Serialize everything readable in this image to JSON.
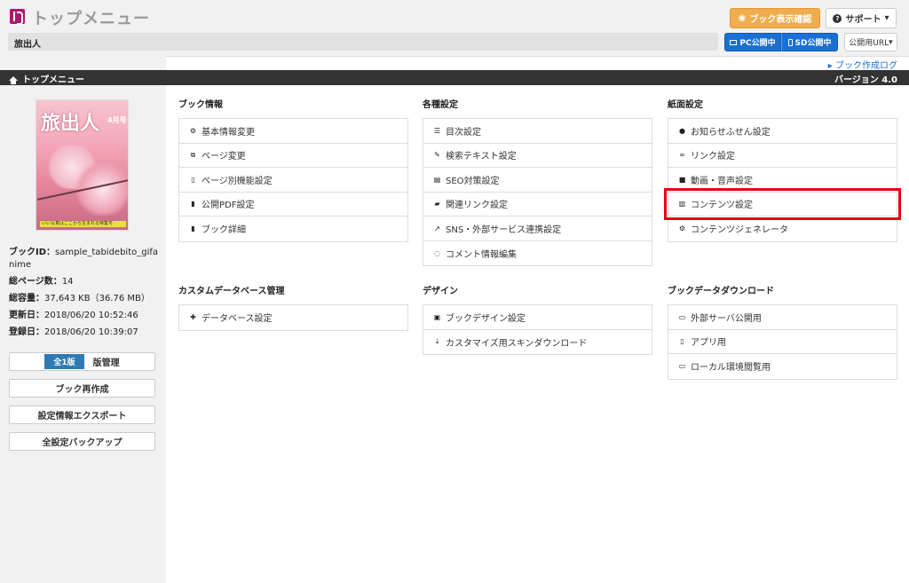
{
  "header": {
    "app_title": "トップメニュー",
    "book_view_button": "ブック表示確認",
    "support_button": "サポート",
    "book_name": "旅出人",
    "pc_publish": "PC公開中",
    "sd_publish": "SD公開中",
    "public_url": "公開用URL"
  },
  "log_link": "ブック作成ログ",
  "nav": {
    "breadcrumb": "トップメニュー",
    "version": "バージョン 4.0"
  },
  "sidebar": {
    "cover": {
      "title": "旅出人",
      "issue": "4月号",
      "strip_text": "いい写真はここから生まれる特集号"
    },
    "book_id_label": "ブックID：",
    "book_id_value": "sample_tabidebito_gifanime",
    "pages_label": "総ページ数：",
    "pages_value": "14",
    "size_label": "総容量：",
    "size_value": "37,643 KB（36.76 MB）",
    "updated_label": "更新日：",
    "updated_value": "2018/06/20 10:52:46",
    "registered_label": "登録日：",
    "registered_value": "2018/06/20 10:39:07",
    "version_badge": "全1版",
    "version_manage": "版管理",
    "rebuild_button": "ブック再作成",
    "export_button": "設定情報エクスポート",
    "backup_button": "全設定バックアップ"
  },
  "sections": {
    "book_info": {
      "title": "ブック情報",
      "items": [
        "基本情報変更",
        "ページ変更",
        "ページ別機能設定",
        "公開PDF設定",
        "ブック詳細"
      ]
    },
    "settings": {
      "title": "各種設定",
      "items": [
        "目次設定",
        "検索テキスト設定",
        "SEO対策設定",
        "関連リンク設定",
        "SNS・外部サービス連携設定",
        "コメント情報編集"
      ]
    },
    "paper": {
      "title": "紙面設定",
      "items": [
        "お知らせふせん設定",
        "リンク設定",
        "動画・音声設定",
        "コンテンツ設定",
        "コンテンツジェネレータ"
      ]
    },
    "custom_db": {
      "title": "カスタムデータベース管理",
      "items": [
        "データベース設定"
      ]
    },
    "design": {
      "title": "デザイン",
      "items": [
        "ブックデザイン設定",
        "カスタマイズ用スキンダウンロード"
      ]
    },
    "download": {
      "title": "ブックデータダウンロード",
      "items": [
        "外部サーバ公開用",
        "アプリ用",
        "ローカル環境閲覧用"
      ]
    }
  },
  "colors": {
    "accent_orange": "#f0ad4e",
    "publish_blue": "#1a6fd4",
    "highlight_red": "#e60012",
    "brand_magenta": "#b0146d"
  }
}
